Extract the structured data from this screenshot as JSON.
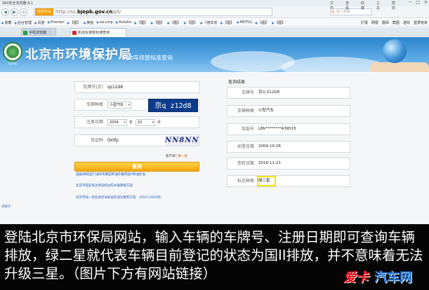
{
  "browser": {
    "title": "360安全浏览器 8.1",
    "secure_label": "党政机关",
    "url_prefix": "http://ss.",
    "url_domain": "bjepb.gov.cn",
    "url_path": "/pf/",
    "search_placeholder": "买二手车",
    "tools": [
      "文件",
      "查看",
      "收藏",
      "工具",
      "帮助"
    ],
    "win_controls": [
      "─",
      "□",
      "✕"
    ],
    "bookmarks": [
      "收藏",
      "后台管理",
      "百度",
      "Premier",
      "【图】",
      "奥拓",
      "oa.corp",
      "Autoho",
      "【图】",
      "【图】",
      "【图】",
      "【图】",
      "《用车实",
      "【图】",
      "MOTUL",
      "【图】",
      "【图】"
    ],
    "bookmarks_right": [
      "扩展",
      "网银",
      "翻译",
      "截图",
      "游戏",
      "登录管家"
    ],
    "tabs": [
      {
        "label": "手机浏览器",
        "active": false
      },
      {
        "label": "机动车排放标准查询",
        "active": true
      }
    ]
  },
  "header": {
    "site_name": "北京市环境保护局",
    "subtitle": "机动车排放标准查询",
    "emblem_text": "北京环保"
  },
  "form": {
    "plate_label": "车牌号(京)",
    "plate_value": "qz12d8",
    "plate_preview": "京q z12d8",
    "vehicle_type_label": "车辆种类",
    "vehicle_type_value": "小型汽车",
    "reg_date_label": "注册日期",
    "reg_year": "2004",
    "reg_year_unit": "年",
    "reg_month": "10",
    "reg_month_unit": "月",
    "captcha_label": "验证码",
    "captcha_value": "tb0fp",
    "captcha_image_text": "NN8NN",
    "refresh_prefix": "看不清?",
    "refresh_link": "换一张",
    "query_button": "查询"
  },
  "links": [
    "国国I辆轻型汽油车和重型柴油车推荐国V燃油标准",
    "北京市提前淘汰老旧机动车补贴政策方案",
    "北京市进一步促进老旧机动车淘汰更新方案 （2015-2016年）"
  ],
  "stat_link": "点统计",
  "result": {
    "title": "查询结果",
    "rows": [
      {
        "label": "车牌号",
        "value": "京Q Z12D8"
      },
      {
        "label": "车辆种类",
        "value": "小型汽车"
      },
      {
        "label": "车架号",
        "value": "LBV********A39515"
      },
      {
        "label": "初登日期",
        "value": "2004-10-26"
      },
      {
        "label": "参检日期",
        "value": "2016-11-21"
      },
      {
        "label": "标志种类",
        "value": "绿二星"
      }
    ]
  },
  "caption": {
    "text": "登陆北京市环保局网站，输入车辆的车牌号、注册日期即可查询车辆排放，绿二星就代表车辆目前登记的状态为国II排放，并不意味着无法升级三星。（图片下方有网站链接）"
  },
  "watermark": {
    "red": "爱卡",
    "blue": "汽车网"
  },
  "colors": {
    "header_blue": "#2a85cc",
    "query_orange": "#f4a60a",
    "highlight_yellow": "#ffe100",
    "plate_blue": "#0b3c8c"
  }
}
